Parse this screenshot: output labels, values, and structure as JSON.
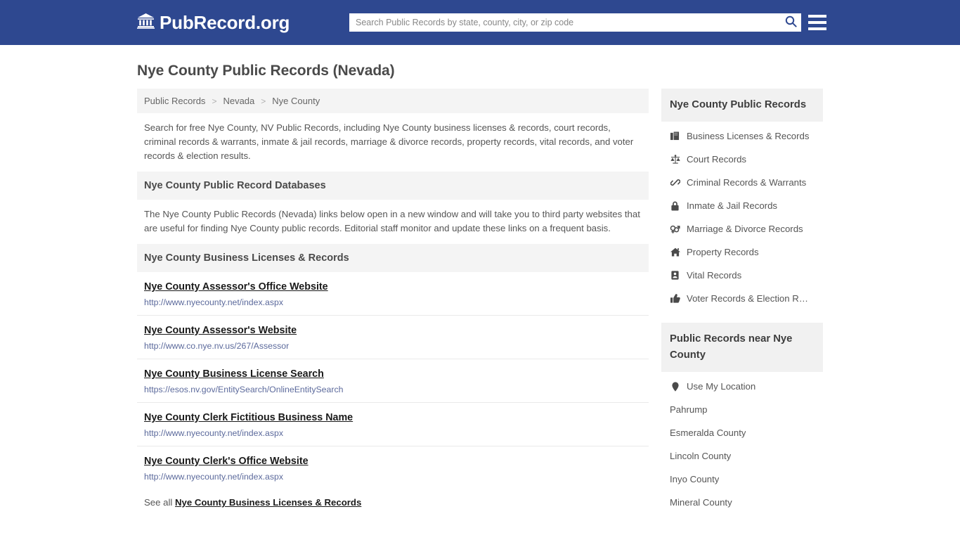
{
  "header": {
    "logo_text": "PubRecord.org",
    "logo_icon": "bank-building-icon",
    "search": {
      "placeholder": "Search Public Records by state, county, city, or zip code",
      "value": "",
      "button_icon": "search-icon"
    },
    "menu_icon": "hamburger-menu-icon",
    "background_color": "#2e4890"
  },
  "page": {
    "title": "Nye County Public Records (Nevada)"
  },
  "breadcrumb": {
    "items": [
      {
        "label": "Public Records"
      },
      {
        "label": "Nevada"
      },
      {
        "label": "Nye County"
      }
    ],
    "separator": ">"
  },
  "intro": {
    "text": "Search for free Nye County, NV Public Records, including Nye County business licenses & records, court records, criminal records & warrants, inmate & jail records, marriage & divorce records, property records, vital records, and voter records & election results."
  },
  "databases_section": {
    "heading": "Nye County Public Record Databases",
    "text": "The Nye County Public Records (Nevada) links below open in a new window and will take you to third party websites that are useful for finding Nye County public records. Editorial staff monitor and update these links on a frequent basis."
  },
  "business_section": {
    "heading": "Nye County Business Licenses & Records",
    "links": [
      {
        "title": "Nye County Assessor's Office Website",
        "url": "http://www.nyecounty.net/index.aspx"
      },
      {
        "title": "Nye County Assessor's Website",
        "url": "http://www.co.nye.nv.us/267/Assessor"
      },
      {
        "title": "Nye County Business License Search",
        "url": "https://esos.nv.gov/EntitySearch/OnlineEntitySearch"
      },
      {
        "title": "Nye County Clerk Fictitious Business Name",
        "url": "http://www.nyecounty.net/index.aspx"
      },
      {
        "title": "Nye County Clerk's Office Website",
        "url": "http://www.nyecounty.net/index.aspx"
      }
    ],
    "see_all_prefix": "See all",
    "see_all_link": "Nye County Business Licenses & Records"
  },
  "sidebar": {
    "records_panel": {
      "heading": "Nye County Public Records",
      "items": [
        {
          "label": "Business Licenses & Records",
          "icon": "briefcase-icon"
        },
        {
          "label": "Court Records",
          "icon": "scales-of-justice-icon"
        },
        {
          "label": "Criminal Records & Warrants",
          "icon": "handcuffs-icon"
        },
        {
          "label": "Inmate & Jail Records",
          "icon": "lock-icon"
        },
        {
          "label": "Marriage & Divorce Records",
          "icon": "venus-mars-icon"
        },
        {
          "label": "Property Records",
          "icon": "home-icon"
        },
        {
          "label": "Vital Records",
          "icon": "id-card-icon"
        },
        {
          "label": "Voter Records & Election R…",
          "icon": "thumbs-up-icon"
        }
      ]
    },
    "nearby_panel": {
      "heading": "Public Records near Nye County",
      "items": [
        {
          "label": "Use My Location",
          "icon": "map-pin-icon"
        },
        {
          "label": "Pahrump",
          "icon": ""
        },
        {
          "label": "Esmeralda County",
          "icon": ""
        },
        {
          "label": "Lincoln County",
          "icon": ""
        },
        {
          "label": "Inyo County",
          "icon": ""
        },
        {
          "label": "Mineral County",
          "icon": ""
        }
      ]
    }
  }
}
